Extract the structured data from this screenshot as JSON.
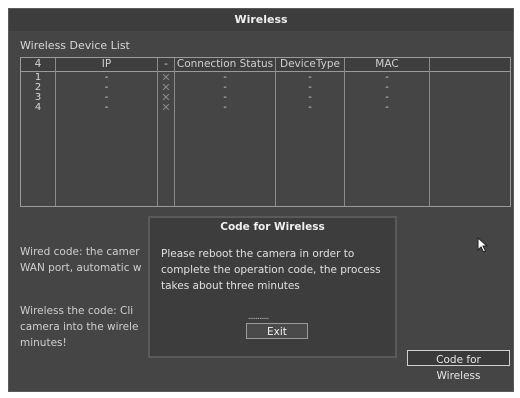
{
  "window": {
    "title": "Wireless"
  },
  "device_list": {
    "label": "Wireless Device List",
    "columns": [
      "4",
      "IP",
      "-",
      "Connection Status",
      "DeviceType",
      "MAC"
    ],
    "rows": [
      {
        "num": "1",
        "ip": "-",
        "conn": "-",
        "type": "-",
        "mac": "-"
      },
      {
        "num": "2",
        "ip": "-",
        "conn": "-",
        "type": "-",
        "mac": "-"
      },
      {
        "num": "3",
        "ip": "-",
        "conn": "-",
        "type": "-",
        "mac": "-"
      },
      {
        "num": "4",
        "ip": "-",
        "conn": "-",
        "type": "-",
        "mac": "-"
      }
    ]
  },
  "descriptions": {
    "wired_line1": "Wired code: the camer",
    "wired_line2": "WAN port, automatic w",
    "wireless_line1": "Wireless the code: Cli",
    "wireless_line2": "camera into the wirele",
    "wireless_line3": "minutes!"
  },
  "code_button": {
    "label": "Code for Wireless"
  },
  "dialog": {
    "title": "Code for Wireless",
    "message": "Please reboot the camera in order to complete the operation code, the process takes about three minutes",
    "progress": "...........",
    "exit_label": "Exit"
  },
  "colors": {
    "window_bg": "#454545",
    "dialog_bg": "#3d3d3d",
    "grid_line": "#8a8a8a"
  },
  "icons": {
    "row_status": "close-icon",
    "pointer": "mouse-cursor-icon"
  }
}
